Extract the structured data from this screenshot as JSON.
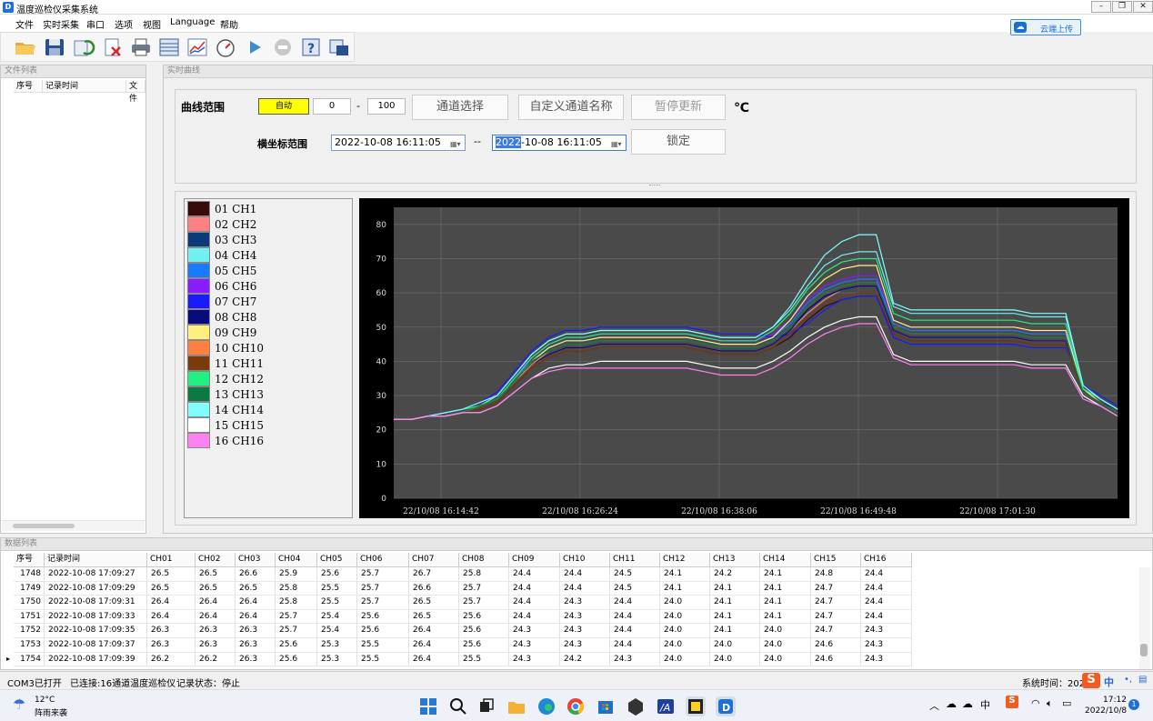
{
  "window": {
    "title": "温度巡检仪采集系统",
    "icon": "app-logo-icon"
  },
  "menu": [
    "文件",
    "实时采集",
    "串口",
    "选项",
    "视图",
    "Language",
    "帮助"
  ],
  "upload_label": "云端上传",
  "file_panel": {
    "title": "文件列表",
    "columns": [
      "序号",
      "记录时间",
      "文件"
    ]
  },
  "chart_panel": {
    "title": "实时曲线",
    "range_label": "曲线范围",
    "auto_label": "自动",
    "min": "0",
    "max": "100",
    "dash": "-",
    "channel_select": "通道选择",
    "custom_names": "自定义通道名称",
    "pause": "暂停更新",
    "unit": "℃",
    "x_range_label": "横坐标范围",
    "start_date": "2022-10-08 16:11:05",
    "date_sep": "--",
    "end_date_sel": "2022",
    "end_date_rest": "-10-08 16:11:05",
    "lock": "锁定"
  },
  "legend": [
    {
      "label": "01 CH1",
      "color": "#3a0a0a"
    },
    {
      "label": "02 CH2",
      "color": "#ff8080"
    },
    {
      "label": "03 CH3",
      "color": "#0a3a7a"
    },
    {
      "label": "04 CH4",
      "color": "#70f0f0"
    },
    {
      "label": "05 CH5",
      "color": "#1a7aff"
    },
    {
      "label": "06 CH6",
      "color": "#8a1aff"
    },
    {
      "label": "07 CH7",
      "color": "#1a1aff"
    },
    {
      "label": "08 CH8",
      "color": "#0a0a7a"
    },
    {
      "label": "09 CH9",
      "color": "#fff080"
    },
    {
      "label": "10 CH10",
      "color": "#ff8040"
    },
    {
      "label": "11 CH11",
      "color": "#7a3a0a"
    },
    {
      "label": "12 CH12",
      "color": "#20f080"
    },
    {
      "label": "13 CH13",
      "color": "#0a7a40"
    },
    {
      "label": "14 CH14",
      "color": "#80ffff"
    },
    {
      "label": "15 CH15",
      "color": "#ffffff"
    },
    {
      "label": "16 CH16",
      "color": "#ff80f0"
    }
  ],
  "chart_data": {
    "type": "line",
    "ylim": [
      0,
      85
    ],
    "yticks": [
      0,
      10,
      20,
      30,
      40,
      50,
      60,
      70,
      80
    ],
    "xticks": [
      "22/10/08 16:14:42",
      "22/10/08 16:26:24",
      "22/10/08 16:38:06",
      "22/10/08 16:49:48",
      "22/10/08 17:01:30"
    ],
    "x": [
      0,
      4,
      8,
      12,
      16,
      20,
      24,
      28,
      32,
      36,
      40,
      44,
      48,
      52,
      56,
      60,
      64,
      68,
      72,
      76,
      80,
      84,
      88,
      92,
      96,
      100,
      104,
      108,
      112,
      116,
      120,
      124,
      128,
      132,
      136,
      140,
      144,
      148,
      152,
      156,
      160,
      164,
      168
    ],
    "series": [
      {
        "name": "01 CH1",
        "color": "#3a0a0a",
        "values": [
          23,
          23,
          24,
          24,
          25,
          26,
          28,
          33,
          38,
          41,
          43,
          43,
          44,
          44,
          44,
          44,
          44,
          44,
          43,
          42,
          42,
          42,
          44,
          47,
          52,
          56,
          58,
          59,
          59,
          48,
          46,
          46,
          46,
          46,
          46,
          46,
          46,
          45,
          45,
          45,
          31,
          28,
          25
        ]
      },
      {
        "name": "02 CH2",
        "color": "#ff8080",
        "values": [
          23,
          23,
          24,
          24,
          25,
          27,
          29,
          34,
          39,
          42,
          44,
          44,
          45,
          45,
          45,
          45,
          45,
          45,
          44,
          43,
          43,
          43,
          45,
          49,
          54,
          58,
          61,
          62,
          62,
          49,
          47,
          47,
          47,
          47,
          47,
          47,
          47,
          46,
          46,
          46,
          31,
          28,
          25
        ]
      },
      {
        "name": "03 CH3",
        "color": "#0a3a7a",
        "values": [
          23,
          23,
          24,
          25,
          26,
          27,
          29,
          34,
          39,
          43,
          45,
          45,
          46,
          46,
          46,
          46,
          46,
          46,
          45,
          44,
          44,
          44,
          46,
          50,
          55,
          59,
          61,
          62,
          62,
          50,
          48,
          48,
          48,
          48,
          48,
          48,
          48,
          47,
          47,
          47,
          32,
          28,
          26
        ]
      },
      {
        "name": "04 CH4",
        "color": "#70f0f0",
        "values": [
          23,
          23,
          24,
          25,
          26,
          27,
          30,
          36,
          42,
          46,
          48,
          48,
          49,
          49,
          49,
          49,
          49,
          49,
          48,
          47,
          47,
          47,
          50,
          55,
          62,
          68,
          71,
          72,
          72,
          56,
          54,
          54,
          54,
          54,
          54,
          54,
          54,
          53,
          53,
          53,
          33,
          29,
          26
        ]
      },
      {
        "name": "05 CH5",
        "color": "#1a7aff",
        "values": [
          23,
          23,
          24,
          25,
          26,
          27,
          29,
          35,
          40,
          44,
          46,
          46,
          47,
          47,
          47,
          47,
          47,
          47,
          46,
          45,
          45,
          45,
          47,
          51,
          57,
          61,
          63,
          64,
          64,
          51,
          49,
          49,
          49,
          49,
          49,
          49,
          49,
          48,
          48,
          48,
          32,
          29,
          26
        ]
      },
      {
        "name": "06 CH6",
        "color": "#8a1aff",
        "values": [
          23,
          23,
          24,
          25,
          26,
          28,
          30,
          36,
          41,
          45,
          47,
          47,
          48,
          48,
          48,
          48,
          48,
          48,
          47,
          46,
          46,
          46,
          48,
          52,
          58,
          62,
          64,
          65,
          65,
          52,
          50,
          50,
          50,
          50,
          50,
          50,
          50,
          49,
          49,
          49,
          32,
          29,
          26
        ]
      },
      {
        "name": "07 CH7",
        "color": "#1a1aff",
        "values": [
          23,
          23,
          24,
          25,
          26,
          28,
          31,
          37,
          43,
          47,
          49,
          49,
          50,
          50,
          50,
          50,
          50,
          50,
          49,
          48,
          48,
          48,
          47,
          48,
          51,
          55,
          58,
          59,
          59,
          47,
          45,
          45,
          45,
          45,
          45,
          45,
          45,
          44,
          44,
          44,
          33,
          30,
          27
        ]
      },
      {
        "name": "08 CH8",
        "color": "#0a0a7a",
        "values": [
          23,
          23,
          24,
          25,
          26,
          27,
          29,
          34,
          39,
          42,
          44,
          44,
          45,
          45,
          45,
          45,
          45,
          45,
          44,
          43,
          43,
          43,
          45,
          49,
          55,
          59,
          61,
          62,
          62,
          49,
          47,
          47,
          47,
          47,
          47,
          47,
          47,
          46,
          46,
          46,
          31,
          28,
          25
        ]
      },
      {
        "name": "09 CH9",
        "color": "#fff080",
        "values": [
          23,
          23,
          24,
          24,
          25,
          27,
          29,
          34,
          40,
          44,
          46,
          46,
          47,
          47,
          47,
          47,
          47,
          47,
          46,
          45,
          45,
          45,
          47,
          52,
          59,
          64,
          67,
          68,
          68,
          52,
          50,
          50,
          50,
          50,
          50,
          50,
          50,
          49,
          49,
          49,
          32,
          28,
          25
        ]
      },
      {
        "name": "10 CH10",
        "color": "#ff8040",
        "values": [
          23,
          23,
          24,
          24,
          25,
          27,
          29,
          34,
          39,
          43,
          45,
          45,
          46,
          46,
          46,
          46,
          46,
          46,
          45,
          44,
          44,
          44,
          46,
          50,
          56,
          60,
          62,
          63,
          63,
          50,
          48,
          48,
          48,
          48,
          48,
          48,
          48,
          47,
          47,
          47,
          31,
          28,
          25
        ]
      },
      {
        "name": "11 CH11",
        "color": "#7a3a0a",
        "values": [
          23,
          23,
          24,
          24,
          25,
          26,
          28,
          33,
          38,
          41,
          43,
          43,
          44,
          44,
          44,
          44,
          44,
          44,
          43,
          42,
          42,
          42,
          44,
          48,
          53,
          57,
          59,
          60,
          60,
          48,
          46,
          46,
          46,
          46,
          46,
          46,
          46,
          45,
          45,
          45,
          31,
          28,
          25
        ]
      },
      {
        "name": "12 CH12",
        "color": "#20f080",
        "values": [
          23,
          23,
          24,
          25,
          26,
          27,
          29,
          35,
          41,
          45,
          47,
          47,
          48,
          48,
          48,
          48,
          48,
          48,
          47,
          46,
          46,
          46,
          49,
          54,
          61,
          66,
          69,
          70,
          70,
          54,
          52,
          52,
          52,
          52,
          52,
          52,
          52,
          51,
          51,
          51,
          32,
          29,
          26
        ]
      },
      {
        "name": "13 CH13",
        "color": "#0a7a40",
        "values": [
          23,
          23,
          24,
          24,
          25,
          27,
          29,
          34,
          40,
          43,
          45,
          45,
          46,
          46,
          46,
          46,
          46,
          46,
          45,
          44,
          44,
          44,
          46,
          50,
          56,
          60,
          62,
          63,
          63,
          50,
          48,
          48,
          48,
          48,
          48,
          48,
          48,
          47,
          47,
          47,
          31,
          28,
          25
        ]
      },
      {
        "name": "14 CH14",
        "color": "#80ffff",
        "values": [
          23,
          23,
          24,
          25,
          26,
          28,
          30,
          36,
          42,
          46,
          48,
          48,
          49,
          49,
          49,
          49,
          49,
          49,
          48,
          47,
          47,
          47,
          50,
          56,
          64,
          71,
          75,
          77,
          77,
          57,
          55,
          55,
          55,
          55,
          55,
          55,
          55,
          54,
          54,
          54,
          33,
          29,
          26
        ]
      },
      {
        "name": "15 CH15",
        "color": "#ffffff",
        "values": [
          23,
          23,
          24,
          24,
          25,
          25,
          27,
          31,
          35,
          38,
          39,
          39,
          40,
          40,
          40,
          40,
          40,
          40,
          39,
          38,
          38,
          38,
          40,
          43,
          47,
          50,
          52,
          53,
          53,
          42,
          40,
          40,
          40,
          40,
          40,
          40,
          40,
          39,
          39,
          39,
          30,
          27,
          24
        ]
      },
      {
        "name": "16 CH16",
        "color": "#ff80f0",
        "values": [
          23,
          23,
          24,
          24,
          25,
          25,
          27,
          31,
          35,
          37,
          38,
          38,
          38,
          38,
          38,
          38,
          38,
          38,
          37,
          36,
          36,
          36,
          38,
          41,
          45,
          48,
          50,
          51,
          51,
          41,
          39,
          39,
          39,
          39,
          39,
          39,
          39,
          38,
          38,
          38,
          29,
          27,
          24
        ]
      }
    ]
  },
  "data_panel": {
    "title": "数据列表",
    "columns": [
      "序号",
      "记录时间",
      "CH01",
      "CH02",
      "CH03",
      "CH04",
      "CH05",
      "CH06",
      "CH07",
      "CH08",
      "CH09",
      "CH10",
      "CH11",
      "CH12",
      "CH13",
      "CH14",
      "CH15",
      "CH16"
    ],
    "rows": [
      [
        "1748",
        "2022-10-08 17:09:27",
        "26.5",
        "26.5",
        "26.6",
        "25.9",
        "25.6",
        "25.7",
        "26.7",
        "25.8",
        "24.4",
        "24.4",
        "24.5",
        "24.1",
        "24.2",
        "24.1",
        "24.8",
        "24.4"
      ],
      [
        "1749",
        "2022-10-08 17:09:29",
        "26.5",
        "26.5",
        "26.5",
        "25.8",
        "25.5",
        "25.7",
        "26.6",
        "25.7",
        "24.4",
        "24.4",
        "24.5",
        "24.1",
        "24.1",
        "24.1",
        "24.7",
        "24.4"
      ],
      [
        "1750",
        "2022-10-08 17:09:31",
        "26.4",
        "26.4",
        "26.4",
        "25.8",
        "25.5",
        "25.7",
        "26.5",
        "25.7",
        "24.4",
        "24.3",
        "24.4",
        "24.0",
        "24.1",
        "24.1",
        "24.7",
        "24.4"
      ],
      [
        "1751",
        "2022-10-08 17:09:33",
        "26.4",
        "26.4",
        "26.4",
        "25.7",
        "25.4",
        "25.6",
        "26.5",
        "25.6",
        "24.4",
        "24.3",
        "24.4",
        "24.0",
        "24.1",
        "24.1",
        "24.7",
        "24.4"
      ],
      [
        "1752",
        "2022-10-08 17:09:35",
        "26.3",
        "26.3",
        "26.3",
        "25.7",
        "25.4",
        "25.6",
        "26.4",
        "25.6",
        "24.3",
        "24.3",
        "24.4",
        "24.0",
        "24.1",
        "24.0",
        "24.7",
        "24.3"
      ],
      [
        "1753",
        "2022-10-08 17:09:37",
        "26.3",
        "26.3",
        "26.3",
        "25.6",
        "25.3",
        "25.5",
        "26.4",
        "25.6",
        "24.3",
        "24.3",
        "24.4",
        "24.0",
        "24.0",
        "24.0",
        "24.6",
        "24.3"
      ],
      [
        "1754",
        "2022-10-08 17:09:39",
        "26.2",
        "26.2",
        "26.3",
        "25.6",
        "25.3",
        "25.5",
        "26.4",
        "25.5",
        "24.3",
        "24.2",
        "24.3",
        "24.0",
        "24.0",
        "24.0",
        "24.6",
        "24.3"
      ]
    ]
  },
  "status": {
    "com": "COM3已打开",
    "conn": "已连接:16通道温度巡检仪",
    "record": "记录状态：停止",
    "systime": "系统时间：2022"
  },
  "taskbar": {
    "weather_temp": "12°C",
    "weather_desc": "阵雨来袭",
    "time": "17:12",
    "date": "2022/10/8",
    "ime": "中",
    "notif": "1"
  }
}
